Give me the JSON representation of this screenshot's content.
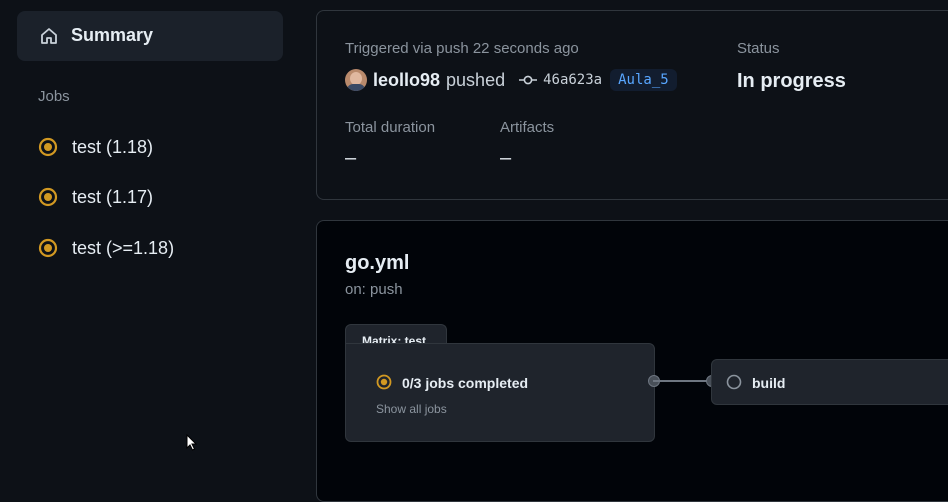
{
  "sidebar": {
    "summary_label": "Summary",
    "summary_icon": "home-icon",
    "jobs_heading": "Jobs",
    "jobs": [
      {
        "label": "test (1.18)",
        "status": "in-progress"
      },
      {
        "label": "test (1.17)",
        "status": "in-progress"
      },
      {
        "label": "test (>=1.18)",
        "status": "in-progress"
      }
    ]
  },
  "summary": {
    "triggered_text": "Triggered via push 22 seconds ago",
    "actor": "leollo98",
    "action": "pushed",
    "commit_sha": "46a623a",
    "branch": "Aula_5",
    "status_label": "Status",
    "status_value": "In progress",
    "duration_label": "Total duration",
    "duration_value": "–",
    "artifacts_label": "Artifacts",
    "artifacts_value": "–"
  },
  "workflow": {
    "name": "go.yml",
    "trigger": "on: push",
    "matrix_label": "Matrix: test",
    "jobs_completed": "0/3 jobs completed",
    "show_all": "Show all jobs",
    "next_job": "build"
  },
  "colors": {
    "in_progress": "#d29922",
    "accent_link": "#58a6ff",
    "background": "#0d1117"
  }
}
